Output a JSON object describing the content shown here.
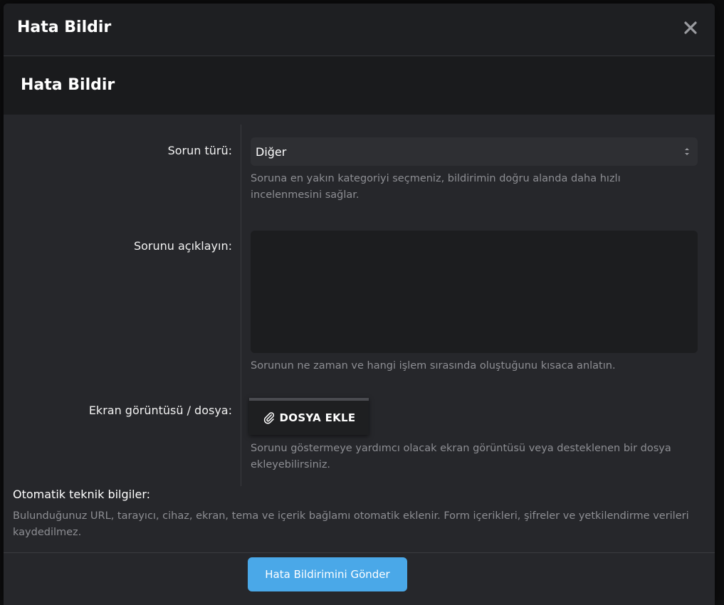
{
  "modal": {
    "title": "Hata Bildir",
    "close_icon": "close-icon"
  },
  "section": {
    "title": "Hata Bildir"
  },
  "form": {
    "issue_type": {
      "label": "Sorun türü:",
      "selected": "Diğer",
      "hint": "Soruna en yakın kategoriyi seçmeniz, bildirimin doğru alanda daha hızlı incelenmesini sağlar."
    },
    "description": {
      "label": "Sorunu açıklayın:",
      "value": "",
      "hint": "Sorunun ne zaman ve hangi işlem sırasında oluştuğunu kısaca anlatın."
    },
    "attachment": {
      "label": "Ekran görüntüsü / dosya:",
      "button_label": "DOSYA EKLE",
      "icon": "paperclip-icon",
      "hint": "Sorunu göstermeye yardımcı olacak ekran görüntüsü veya desteklenen bir dosya ekleyebilirsiniz."
    }
  },
  "auto_info": {
    "title": "Otomatik teknik bilgiler:",
    "text": "Bulunduğunuz URL, tarayıcı, cihaz, ekran, tema ve içerik bağlamı otomatik eklenir. Form içerikleri, şifreler ve yetkilendirme verileri kaydedilmez."
  },
  "footer": {
    "submit_label": "Hata Bildirimini Gönder"
  },
  "colors": {
    "accent": "#4aa8e8",
    "modal_bg": "#26272b",
    "header_bg": "#1e1f22"
  }
}
